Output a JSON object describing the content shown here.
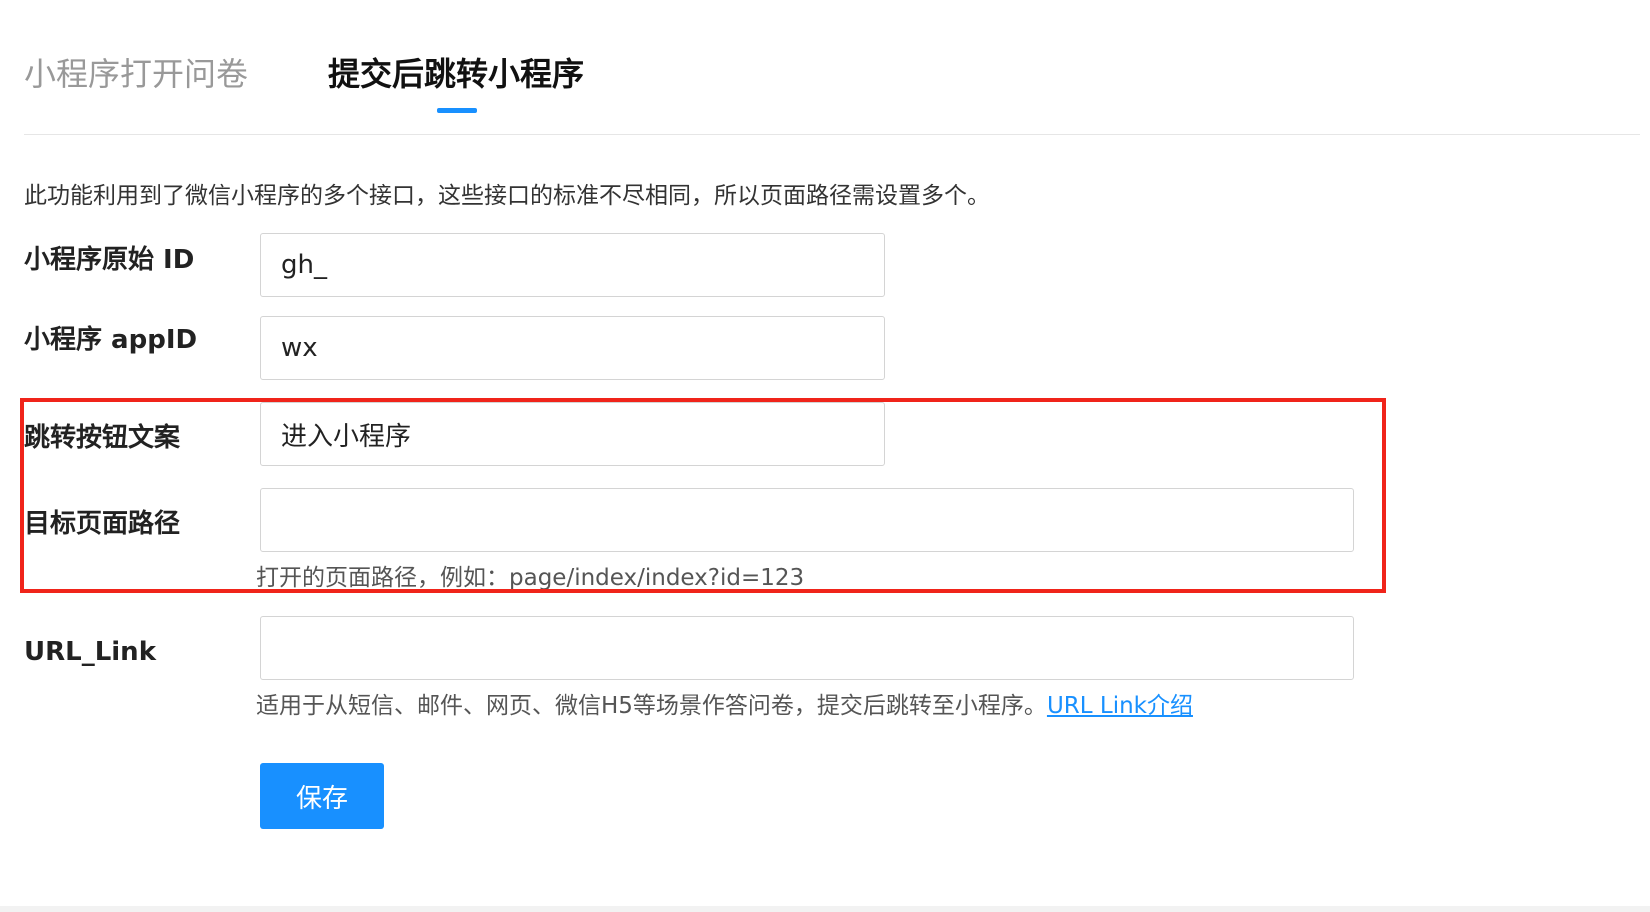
{
  "tabs": [
    {
      "label": "小程序打开问卷",
      "active": false
    },
    {
      "label": "提交后跳转小程序",
      "active": true
    }
  ],
  "description": "此功能利用到了微信小程序的多个接口，这些接口的标准不尽相同，所以页面路径需设置多个。",
  "form": {
    "original_id": {
      "label": "小程序原始 ID",
      "value": "gh_"
    },
    "app_id": {
      "label": "小程序 appID",
      "value": "wx"
    },
    "button_text": {
      "label": "跳转按钮文案",
      "value": "进入小程序"
    },
    "target_path": {
      "label": "目标页面路径",
      "value": "",
      "hint": "打开的页面路径，例如：page/index/index?id=123"
    },
    "url_link": {
      "label": "URL_Link",
      "value": "",
      "hint": "适用于从短信、邮件、网页、微信H5等场景作答问卷，提交后跳转至小程序。",
      "hint_link": "URL Link介绍"
    }
  },
  "save_label": "保存",
  "colors": {
    "accent": "#1890ff",
    "highlight_border": "#f0241a"
  }
}
